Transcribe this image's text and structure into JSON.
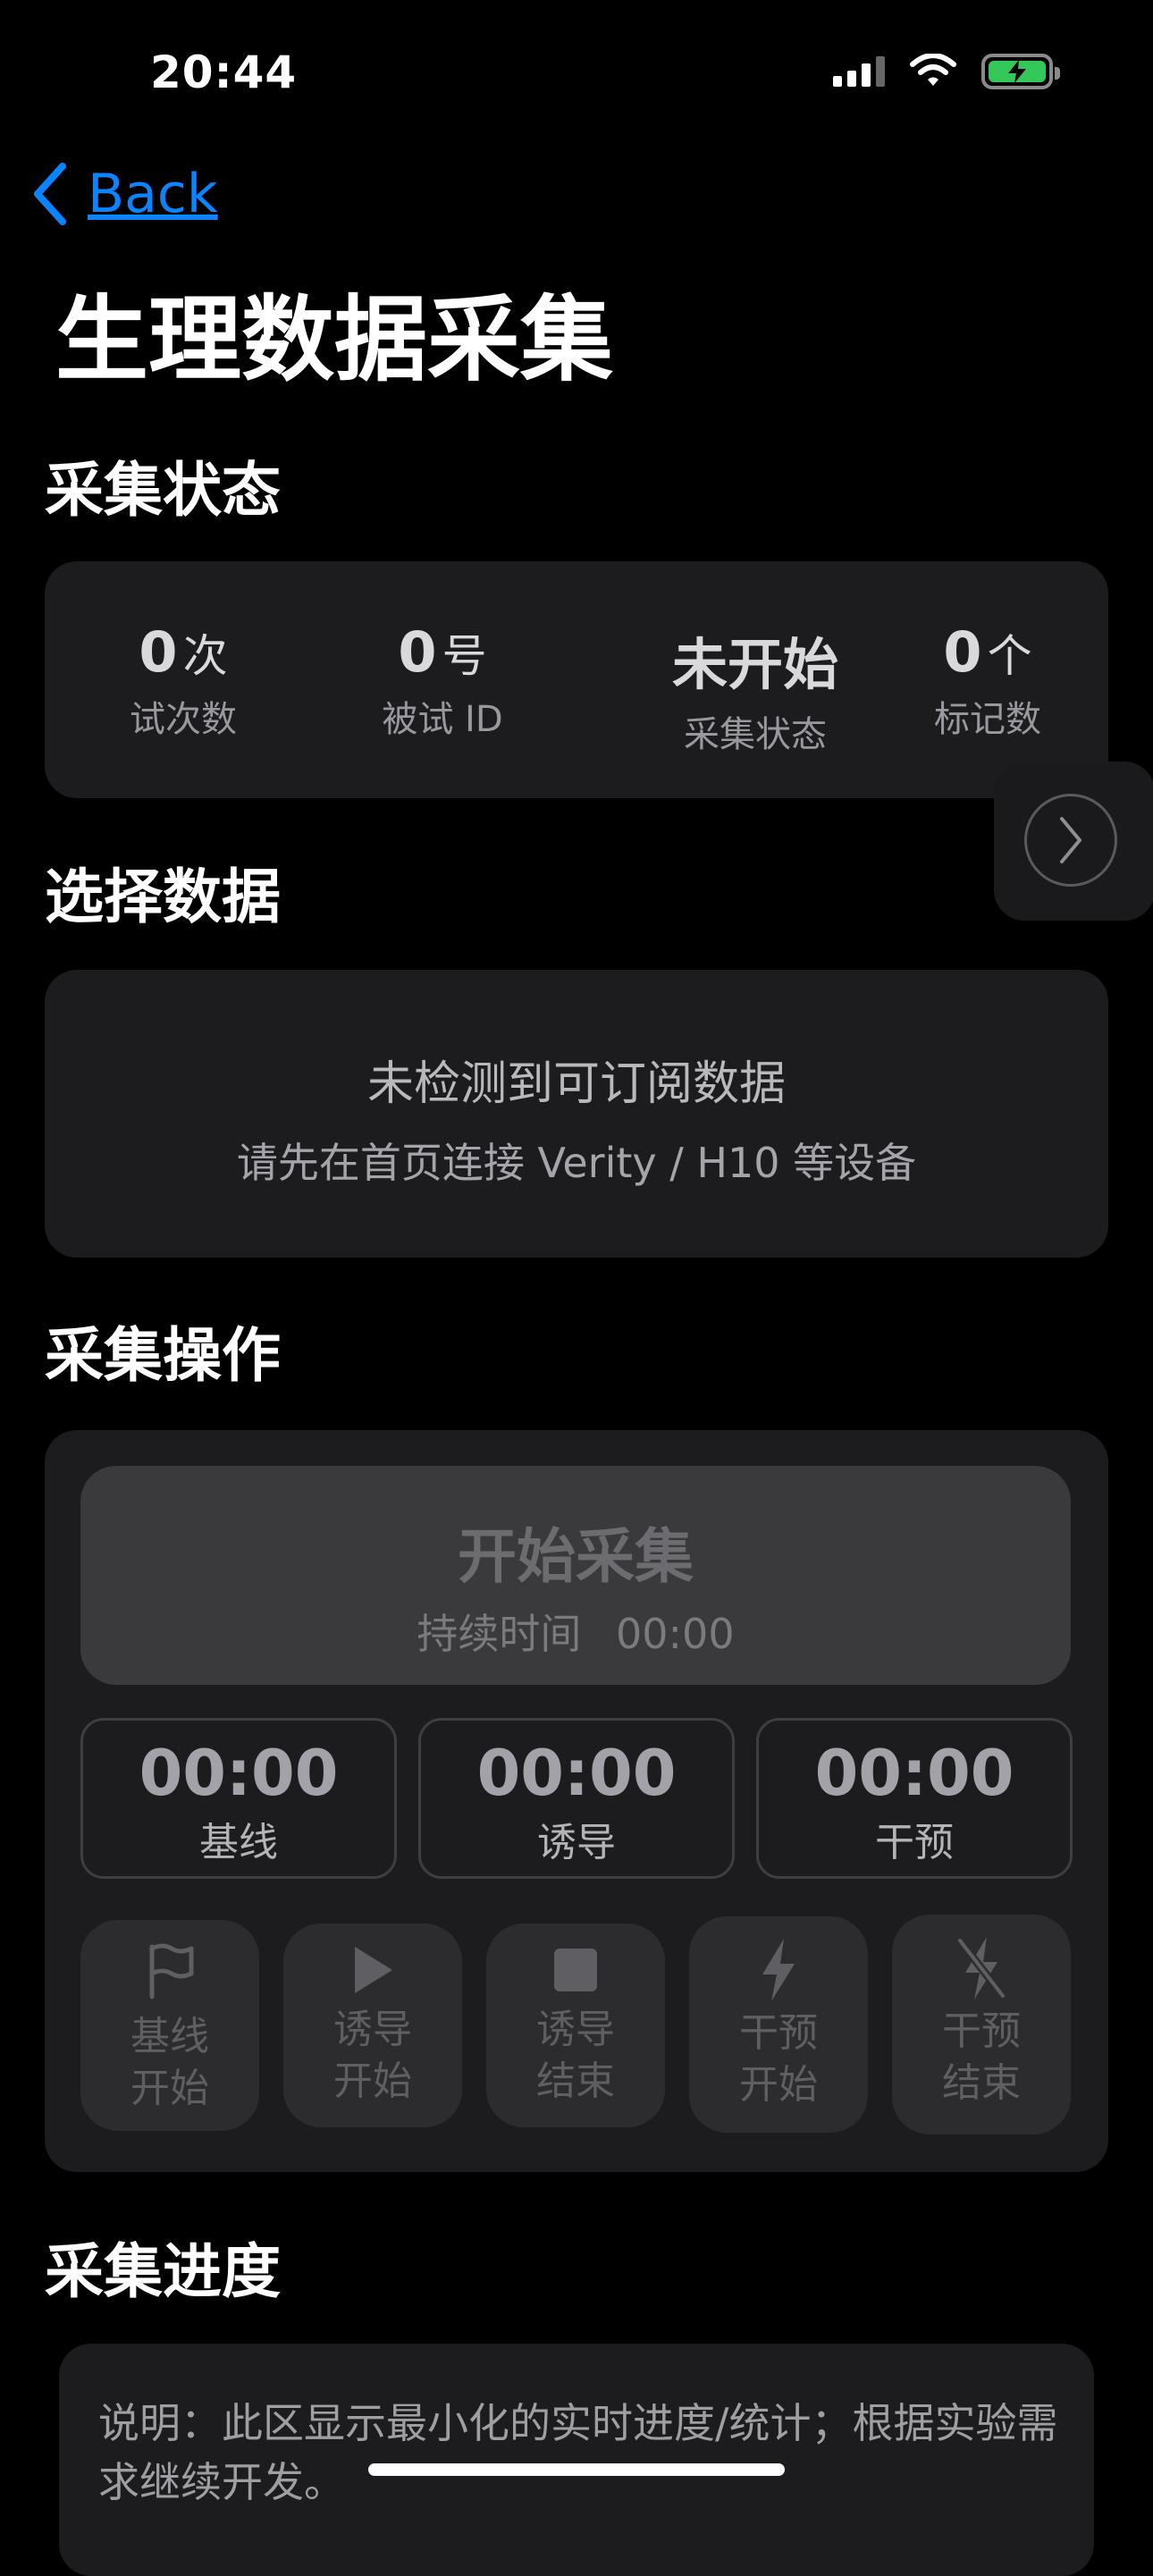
{
  "status_bar": {
    "time": "20:44"
  },
  "nav": {
    "back_label": "Back"
  },
  "page_title": "生理数据采集",
  "sections": {
    "status": "采集状态",
    "select": "选择数据",
    "actions": "采集操作",
    "progress": "采集进度"
  },
  "stats": [
    {
      "value": "0",
      "unit": "次",
      "label": "试次数"
    },
    {
      "value": "0",
      "unit": "号",
      "label": "被试 ID"
    },
    {
      "value": "未开始",
      "unit": "",
      "label": "采集状态"
    },
    {
      "value": "0",
      "unit": "个",
      "label": "标记数"
    }
  ],
  "data_empty": {
    "title": "未检测到可订阅数据",
    "hint": "请先在首页连接 Verity / H10 等设备"
  },
  "start": {
    "label": "开始采集",
    "duration_label": "持续时间",
    "duration": "00:00"
  },
  "timers": [
    {
      "value": "00:00",
      "label": "基线"
    },
    {
      "value": "00:00",
      "label": "诱导"
    },
    {
      "value": "00:00",
      "label": "干预"
    }
  ],
  "markers": [
    {
      "icon": "flag-icon",
      "line1": "基线",
      "line2": "开始"
    },
    {
      "icon": "play-icon",
      "line1": "诱导",
      "line2": "开始"
    },
    {
      "icon": "stop-icon",
      "line1": "诱导",
      "line2": "结束"
    },
    {
      "icon": "bolt-icon",
      "line1": "干预",
      "line2": "开始"
    },
    {
      "icon": "bolt-slash-icon",
      "line1": "干预",
      "line2": "结束"
    }
  ],
  "progress_note": "说明：此区显示最小化的实时进度/统计；根据实验需求继续开发。",
  "colors": {
    "accent": "#0a84ff",
    "battery": "#34c759",
    "card": "#1c1c1e"
  }
}
